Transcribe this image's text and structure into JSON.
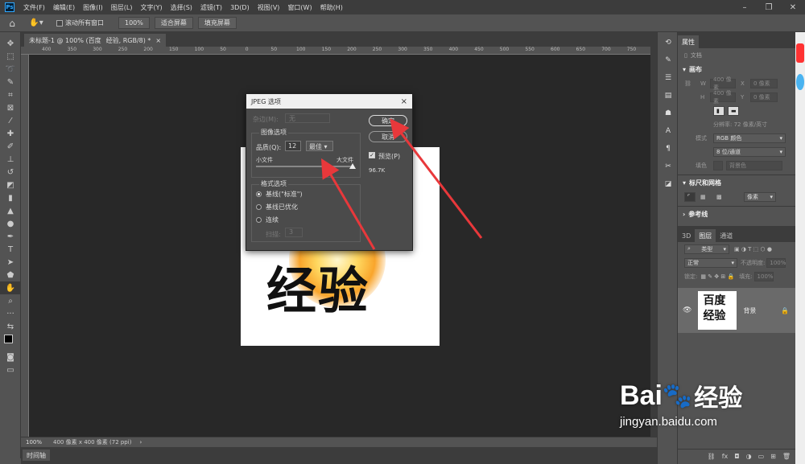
{
  "menubar": {
    "logo": "Ps",
    "items": [
      "文件(F)",
      "编辑(E)",
      "图像(I)",
      "图层(L)",
      "文字(Y)",
      "选择(S)",
      "滤镜(T)",
      "3D(D)",
      "视图(V)",
      "窗口(W)",
      "帮助(H)"
    ]
  },
  "optionsbar": {
    "scroll_all_label": "滚动所有窗口",
    "zoom_value": "100%",
    "fit_screen": "适合屏幕",
    "fill_screen": "填充屏幕"
  },
  "document_tabs": [
    {
      "label": "未标题-1 @ 100% (百度",
      "close": ""
    },
    {
      "label": "经验, RGB/8) *",
      "close": "×"
    }
  ],
  "ruler": {
    "top_ticks": [
      "400",
      "350",
      "300",
      "250",
      "200",
      "150",
      "100",
      "50",
      "0",
      "50",
      "100",
      "150",
      "200",
      "250",
      "300",
      "350",
      "400",
      "450",
      "500",
      "550",
      "600",
      "650",
      "700",
      "750",
      "800"
    ]
  },
  "canvas": {
    "text": "经验"
  },
  "status": {
    "zoom": "100%",
    "doc_info": "400 像素 x 400 像素 (72 ppi)",
    "arrow": "›"
  },
  "timeline": {
    "label": "时间轴"
  },
  "dialog": {
    "title": "JPEG 选项",
    "close": "×",
    "matte_label": "杂边(M):",
    "matte_value": "无",
    "image_options": "图像选项",
    "quality_label": "品质(Q):",
    "quality_value": "12",
    "quality_preset": "最佳",
    "small_file": "小文件",
    "large_file": "大文件",
    "quality_level": 1.0,
    "format_options": "格式选项",
    "format_baseline_standard": "基线(\"标准\")",
    "format_baseline_optimized": "基线已优化",
    "format_progressive": "连续",
    "scans_label": "扫描:",
    "scans_value": "3",
    "ok": "确定",
    "cancel": "取消",
    "preview_label": "预览(P)",
    "file_size": "96.7K"
  },
  "panels": {
    "properties_tab": "属性",
    "doc_label": "文档",
    "canvas_section": "画布",
    "w_label": "W",
    "w_value": "400 像素",
    "x_label": "X",
    "x_value": "0 像素",
    "h_label": "H",
    "h_value": "400 像素",
    "y_label": "Y",
    "y_value": "0 像素",
    "resolution": "分辨率: 72 像素/英寸",
    "mode_label": "模式",
    "mode_value": "RGB 颜色",
    "depth_value": "8 位/通道",
    "fill_label": "填色",
    "fill_value": "背景色",
    "rulers_section": "标尺和网格",
    "ruler_unit": "像素",
    "guides_section": "参考线",
    "layer_tabs": [
      "3D",
      "图层",
      "通道"
    ],
    "layer_filter": "类型",
    "blend_mode": "正常",
    "opacity_label": "不透明度:",
    "opacity_value": "100%",
    "lock_label": "锁定:",
    "fill_pct_label": "填充:",
    "fill_pct_value": "100%",
    "layer_name": "背景",
    "thumb_line1": "百度",
    "thumb_line2": "经验"
  },
  "watermark": {
    "brand": "Bai",
    "brand_suffix": "经验",
    "url": "jingyan.baidu.com"
  },
  "colors": {
    "arrow": "#e8383b",
    "ps_blue": "#31a8ff",
    "glow": "#f9a52c"
  }
}
